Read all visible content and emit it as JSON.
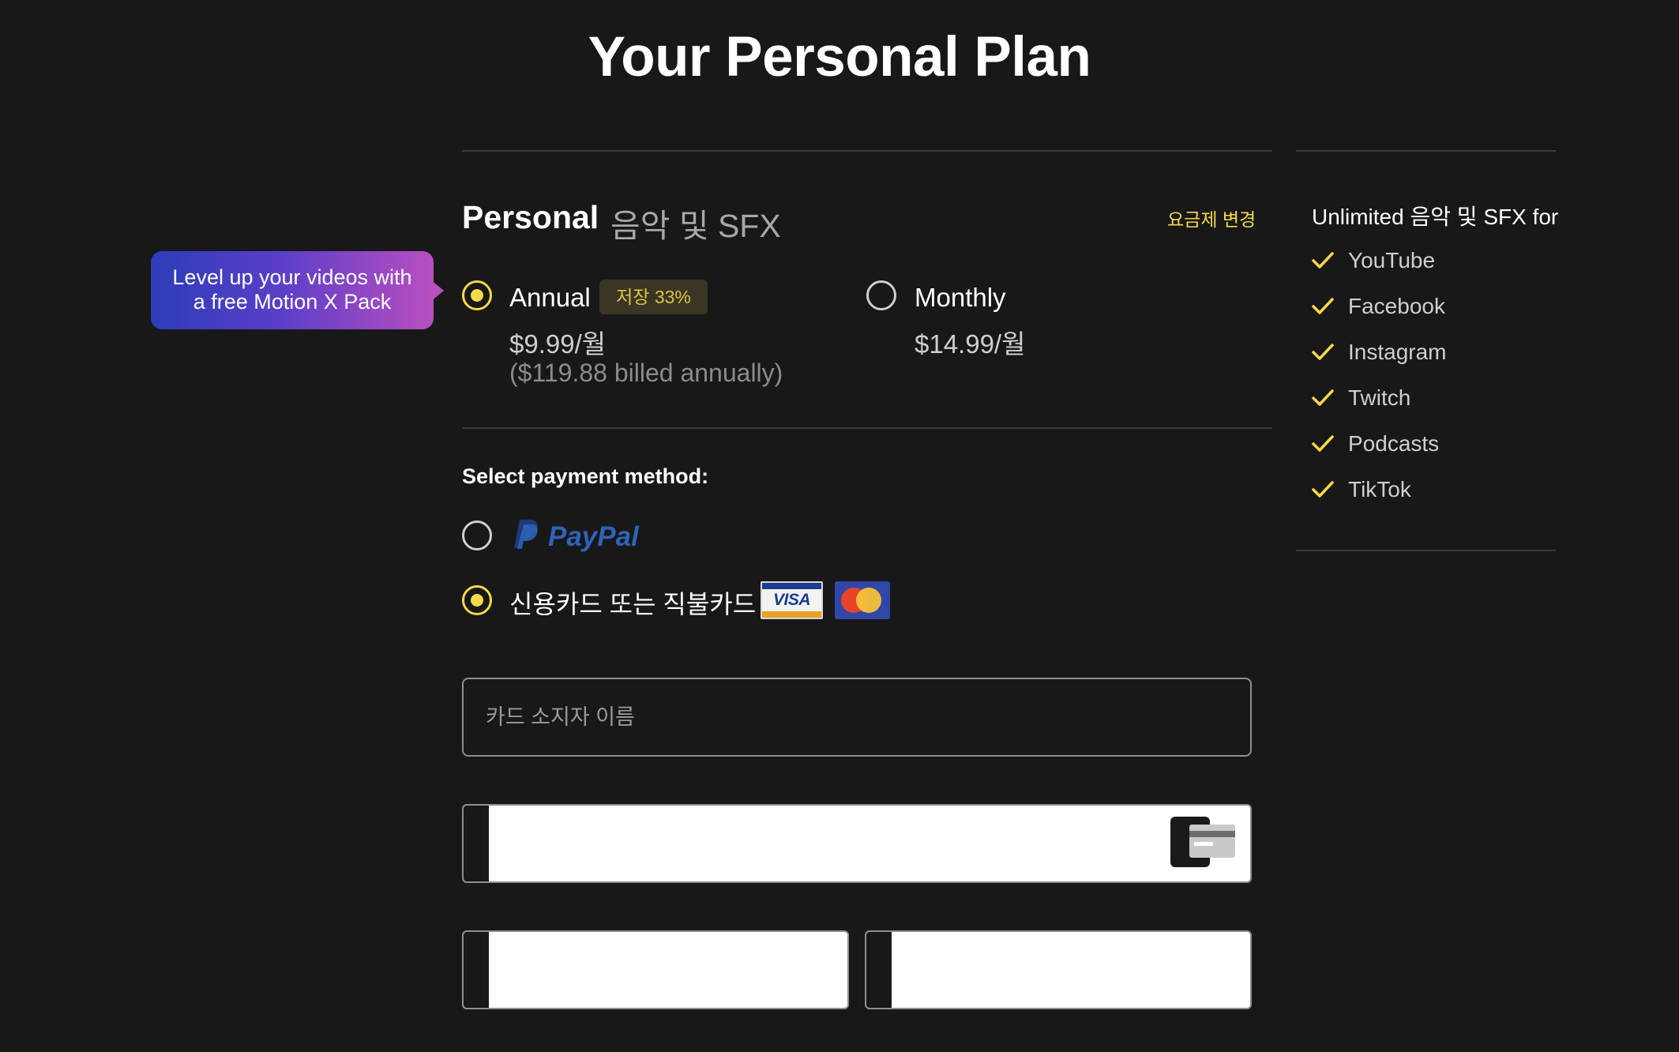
{
  "page_title": "Your Personal Plan",
  "plan": {
    "name": "Personal",
    "subtitle": "음악 및 SFX",
    "change_link": "요금제 변경"
  },
  "promo": {
    "line1": "Level up your videos with",
    "line2": "a free Motion X Pack"
  },
  "billing_options": [
    {
      "label": "Annual",
      "badge": "저장 33%",
      "price": "$9.99/월",
      "billed": "($119.88 billed annually)",
      "selected": true
    },
    {
      "label": "Monthly",
      "price": "$14.99/월",
      "selected": false
    }
  ],
  "payment": {
    "section_label": "Select payment method:",
    "paypal_label": "PayPal",
    "paypal_selected": false,
    "card_label": "신용카드 또는 직불카드",
    "card_selected": true,
    "visa_text": "VISA",
    "cardholder_placeholder": "카드 소지자 이름"
  },
  "features": {
    "title": "Unlimited 음악 및 SFX for",
    "items": [
      "YouTube",
      "Facebook",
      "Instagram",
      "Twitch",
      "Podcasts",
      "TikTok"
    ]
  },
  "colors": {
    "background": "#181818",
    "accent": "#f6d94a",
    "divider": "#3a3a3a",
    "paypal_blue": "#2e63b8"
  }
}
